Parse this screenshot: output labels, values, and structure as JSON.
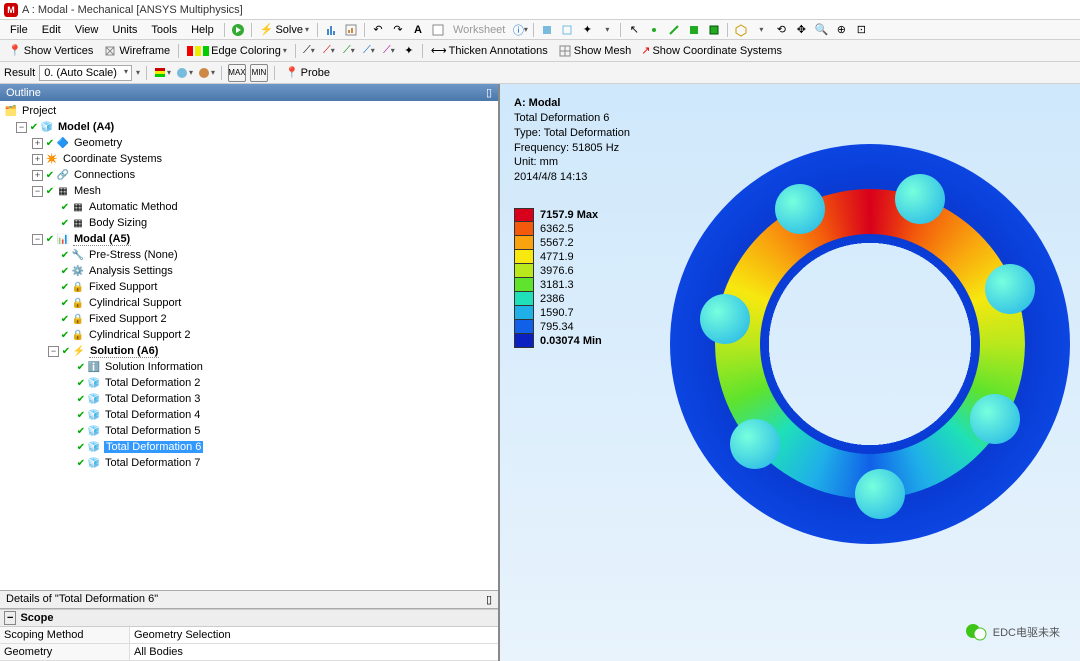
{
  "title": "A : Modal - Mechanical [ANSYS Multiphysics]",
  "menu": [
    "File",
    "Edit",
    "View",
    "Units",
    "Tools",
    "Help"
  ],
  "toolbar1": {
    "solve": "Solve",
    "worksheet": "Worksheet"
  },
  "toolbar2": {
    "show_vertices": "Show Vertices",
    "wireframe": "Wireframe",
    "edge_coloring": "Edge Coloring",
    "thicken": "Thicken Annotations",
    "show_mesh": "Show Mesh",
    "show_cs": "Show Coordinate Systems"
  },
  "result_bar": {
    "label": "Result",
    "scale": "0. (Auto Scale)",
    "probe": "Probe"
  },
  "outline": {
    "header": "Outline",
    "pin": "▯"
  },
  "tree": {
    "project": "Project",
    "model": "Model (A4)",
    "geometry": "Geometry",
    "cs": "Coordinate Systems",
    "connections": "Connections",
    "mesh": "Mesh",
    "auto_method": "Automatic Method",
    "body_sizing": "Body Sizing",
    "modal": "Modal (A5)",
    "prestress": "Pre-Stress (None)",
    "analysis": "Analysis Settings",
    "fixed1": "Fixed Support",
    "cyl1": "Cylindrical Support",
    "fixed2": "Fixed Support 2",
    "cyl2": "Cylindrical Support 2",
    "solution": "Solution (A6)",
    "sol_info": "Solution Information",
    "td2": "Total Deformation 2",
    "td3": "Total Deformation 3",
    "td4": "Total Deformation 4",
    "td5": "Total Deformation 5",
    "td6": "Total Deformation 6",
    "td7": "Total Deformation 7"
  },
  "details": {
    "header": "Details of \"Total Deformation 6\"",
    "scope": "Scope",
    "scoping_method_k": "Scoping Method",
    "scoping_method_v": "Geometry Selection",
    "geometry_k": "Geometry",
    "geometry_v": "All Bodies"
  },
  "viewport": {
    "title": "A: Modal",
    "result": "Total Deformation 6",
    "type": "Type: Total Deformation",
    "freq": "Frequency: 51805 Hz",
    "unit": "Unit: mm",
    "timestamp": "2014/4/8 14:13"
  },
  "legend": [
    {
      "c": "#d8001b",
      "v": "7157.9 Max",
      "b": true
    },
    {
      "c": "#f35a0b",
      "v": "6362.5"
    },
    {
      "c": "#f9a40e",
      "v": "5567.2"
    },
    {
      "c": "#f7e80f",
      "v": "4771.9"
    },
    {
      "c": "#b9e81c",
      "v": "3976.6"
    },
    {
      "c": "#5fe32c",
      "v": "3181.3"
    },
    {
      "c": "#1fe0b8",
      "v": "2386"
    },
    {
      "c": "#1fb0e8",
      "v": "1590.7"
    },
    {
      "c": "#1060e8",
      "v": "795.34"
    },
    {
      "c": "#0a20c0",
      "v": "0.03074 Min",
      "b": true
    }
  ],
  "watermark": "EDC电驱未来"
}
